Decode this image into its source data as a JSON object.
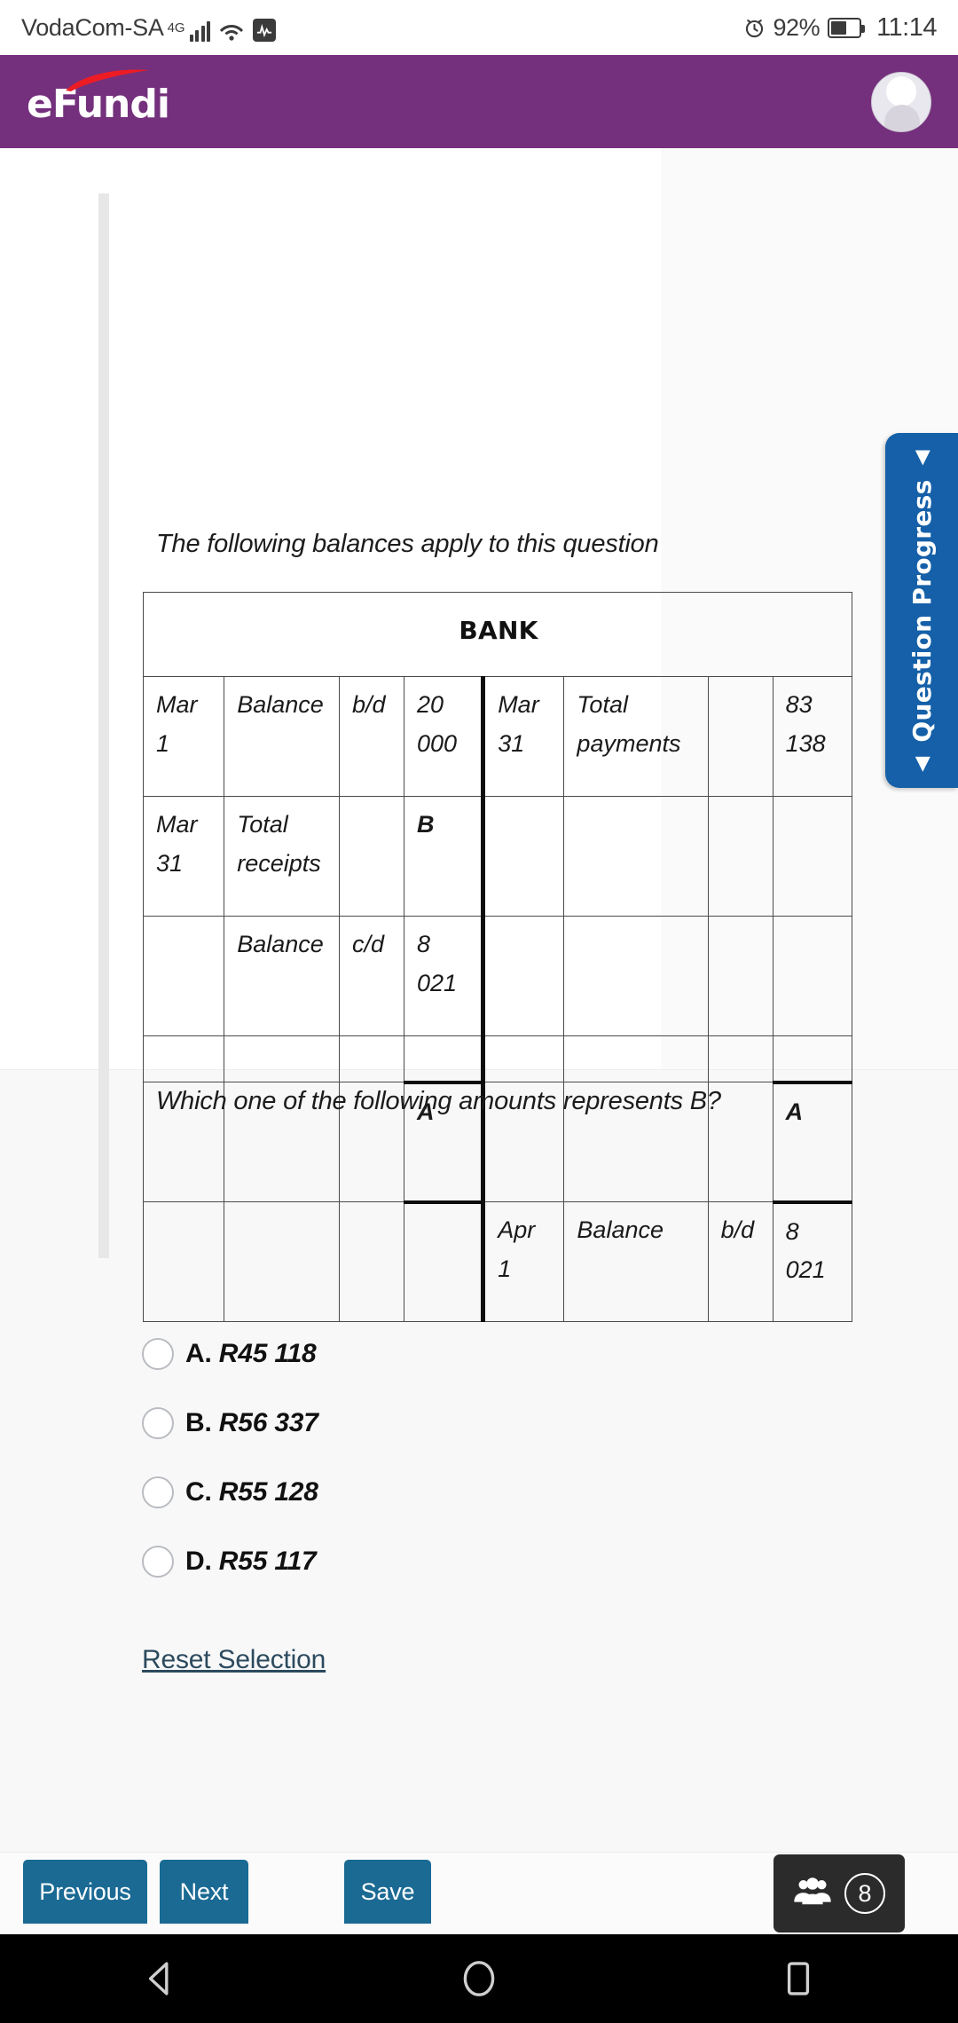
{
  "status_bar": {
    "carrier": "VodaCom-SA",
    "network_type": "4G",
    "battery_percent": "92%",
    "time": "11:14",
    "icons": [
      "signal-bars-icon",
      "wifi-icon",
      "activity-icon",
      "alarm-icon",
      "battery-icon"
    ]
  },
  "app_header": {
    "logo_text_prefix": "e",
    "logo_text_main": "Fundi",
    "brand_color": "#74307c",
    "avatar": "user-avatar"
  },
  "content": {
    "intro_text": "The following balances apply to this question",
    "question_text": "Which one of the following amounts represents B?"
  },
  "bank_table": {
    "title": "BANK",
    "rows": [
      {
        "left": {
          "date": "Mar 1",
          "details": "Balance",
          "fol": "b/d",
          "amount": "20 000"
        },
        "right": {
          "date": "Mar 31",
          "details": "Total payments",
          "fol": "",
          "amount": "83 138"
        }
      },
      {
        "left": {
          "date": "Mar 31",
          "details": "Total receipts",
          "fol": "",
          "amount": "B"
        },
        "right": {
          "date": "",
          "details": "",
          "fol": "",
          "amount": ""
        }
      },
      {
        "left": {
          "date": "",
          "details": "Balance",
          "fol": "c/d",
          "amount": "8 021"
        },
        "right": {
          "date": "",
          "details": "",
          "fol": "",
          "amount": ""
        }
      },
      {
        "left": {
          "date": "",
          "details": "",
          "fol": "",
          "amount": ""
        },
        "right": {
          "date": "",
          "details": "",
          "fol": "",
          "amount": ""
        }
      },
      {
        "left": {
          "date": "",
          "details": "",
          "fol": "",
          "amount": "A"
        },
        "right": {
          "date": "",
          "details": "",
          "fol": "",
          "amount": "A"
        }
      },
      {
        "left": {
          "date": "",
          "details": "",
          "fol": "",
          "amount": ""
        },
        "right": {
          "date": "Apr 1",
          "details": "Balance",
          "fol": "b/d",
          "amount": "8 021"
        }
      }
    ]
  },
  "options": [
    {
      "letter": "A.",
      "amount": "R45 118"
    },
    {
      "letter": "B.",
      "amount": "R56 337"
    },
    {
      "letter": "C.",
      "amount": "R55 128"
    },
    {
      "letter": "D.",
      "amount": "R55 117"
    }
  ],
  "reset_link": "Reset Selection",
  "question_progress": {
    "label": "Question Progress",
    "triangle_left": "◀",
    "triangle_right": "◀",
    "accent_color": "#1560a8"
  },
  "action_bar": {
    "previous": "Previous",
    "next": "Next",
    "save": "Save",
    "people_count": "8",
    "button_color": "#1a6a94"
  },
  "nav_bar": {
    "back": "back-icon",
    "home": "home-icon",
    "recents": "recents-icon"
  }
}
